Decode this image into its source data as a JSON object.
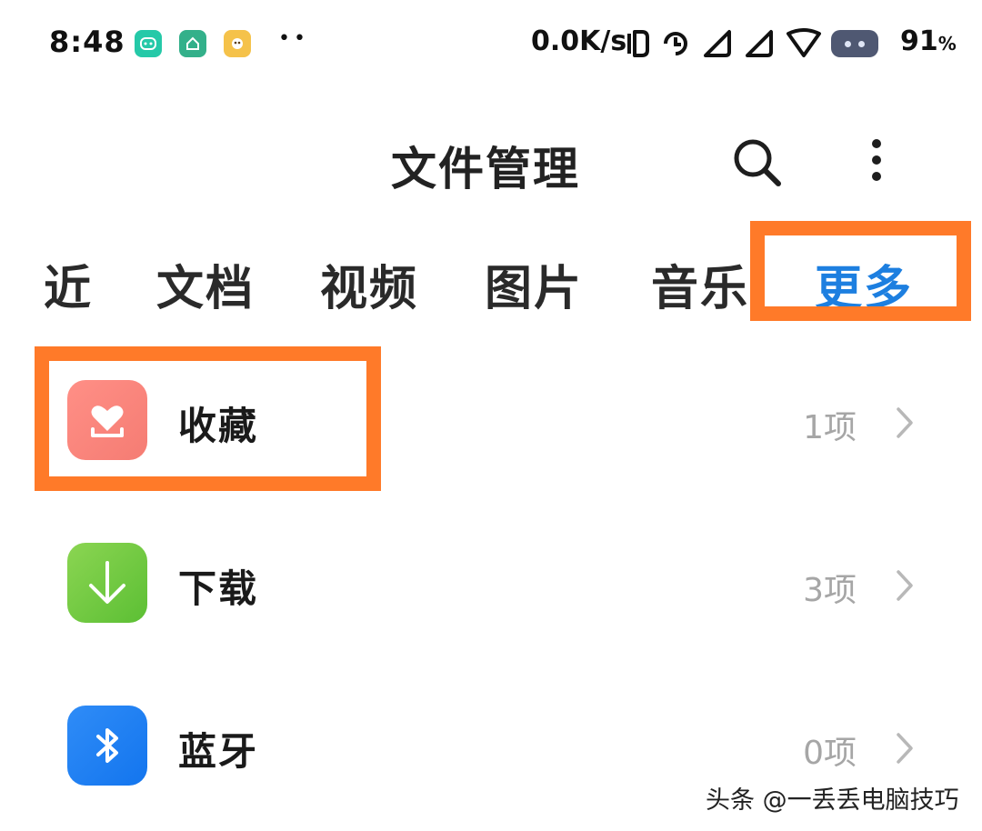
{
  "status_bar": {
    "time": "8:48",
    "more": "••",
    "net_speed": "0.0K/s",
    "battery": "91",
    "battery_unit": "%"
  },
  "header": {
    "title": "文件管理"
  },
  "tabs": [
    {
      "label": "近"
    },
    {
      "label": "文档"
    },
    {
      "label": "视频"
    },
    {
      "label": "图片"
    },
    {
      "label": "音乐"
    },
    {
      "label": "更多",
      "active": true
    }
  ],
  "items": [
    {
      "label": "收藏",
      "count": "1项",
      "icon": "favorites-icon",
      "color": "#f57c73"
    },
    {
      "label": "下载",
      "count": "3项",
      "icon": "download-icon",
      "color": "#5cbf34"
    },
    {
      "label": "蓝牙",
      "count": "0项",
      "icon": "bluetooth-icon",
      "color": "#1375ee"
    }
  ],
  "highlight_color": "#ff7a29",
  "accent_color": "#1d7fe0",
  "watermark": "头条 @一丢丢电脑技巧"
}
